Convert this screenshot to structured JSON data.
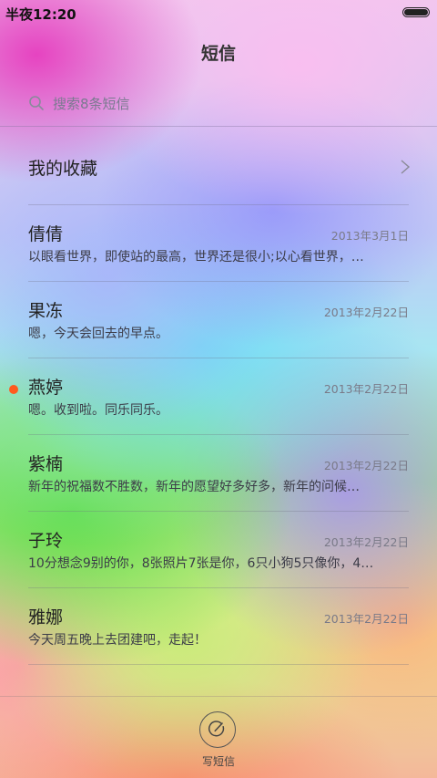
{
  "status_bar": {
    "time": "半夜12:20"
  },
  "header": {
    "title": "短信"
  },
  "search": {
    "placeholder": "搜索8条短信"
  },
  "favorites": {
    "label": "我的收藏"
  },
  "conversations": [
    {
      "name": "倩倩",
      "date": "2013年3月1日",
      "preview": "以眼看世界，即使站的最高，世界还是很小;以心看世界，…",
      "unread": false
    },
    {
      "name": "果冻",
      "date": "2013年2月22日",
      "preview": "嗯，今天会回去的早点。",
      "unread": false
    },
    {
      "name": "燕婷",
      "date": "2013年2月22日",
      "preview": "嗯。收到啦。同乐同乐。",
      "unread": true
    },
    {
      "name": "紫楠",
      "date": "2013年2月22日",
      "preview": "新年的祝福数不胜数，新年的愿望好多好多，新年的问候…",
      "unread": false
    },
    {
      "name": "子玲",
      "date": "2013年2月22日",
      "preview": "10分想念9别的你，8张照片7张是你，6只小狗5只像你，4…",
      "unread": false
    },
    {
      "name": "雅娜",
      "date": "2013年2月22日",
      "preview": "今天周五晚上去团建吧，走起！",
      "unread": false
    }
  ],
  "compose": {
    "label": "写短信"
  },
  "colors": {
    "unread_dot": "#ff5a1e"
  },
  "icons": [
    "search-icon",
    "chevron-right-icon",
    "compose-icon",
    "battery-icon"
  ]
}
